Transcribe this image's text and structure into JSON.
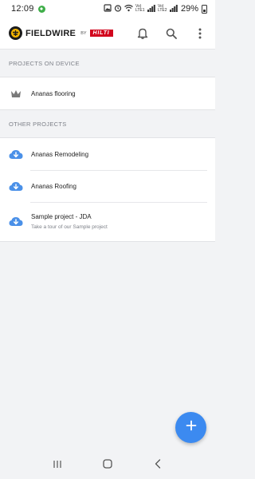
{
  "status_bar": {
    "time": "12:09",
    "network_label": "Vo) LTE1",
    "network_label_2": "Vo) LTE2",
    "battery": "29%"
  },
  "app_bar": {
    "brand_name": "FIELDWIRE",
    "brand_by": "BY",
    "partner_logo": "HILTI",
    "icons": [
      "bell-icon",
      "search-icon",
      "more-vert-icon"
    ]
  },
  "sections": {
    "on_device": {
      "header": "PROJECTS ON DEVICE",
      "items": [
        {
          "title": "Ananas flooring",
          "icon": "crown-icon"
        }
      ]
    },
    "other": {
      "header": "OTHER PROJECTS",
      "items": [
        {
          "title": "Ananas Remodeling",
          "icon": "cloud-download-icon"
        },
        {
          "title": "Ananas Roofing",
          "icon": "cloud-download-icon"
        },
        {
          "title": "Sample project - JDA",
          "subtitle": "Take a tour of our Sample project",
          "icon": "cloud-download-icon"
        }
      ]
    }
  },
  "fab": {
    "icon": "plus-icon"
  },
  "nav_bar": {
    "icons": [
      "recent-apps-icon",
      "home-icon",
      "back-icon"
    ]
  },
  "colors": {
    "accent": "#3c8af0",
    "cloud_icon": "#4a90e8",
    "crown_icon": "#7a7a7a",
    "hilti_red": "#d2051e",
    "background": "#f2f3f5"
  }
}
